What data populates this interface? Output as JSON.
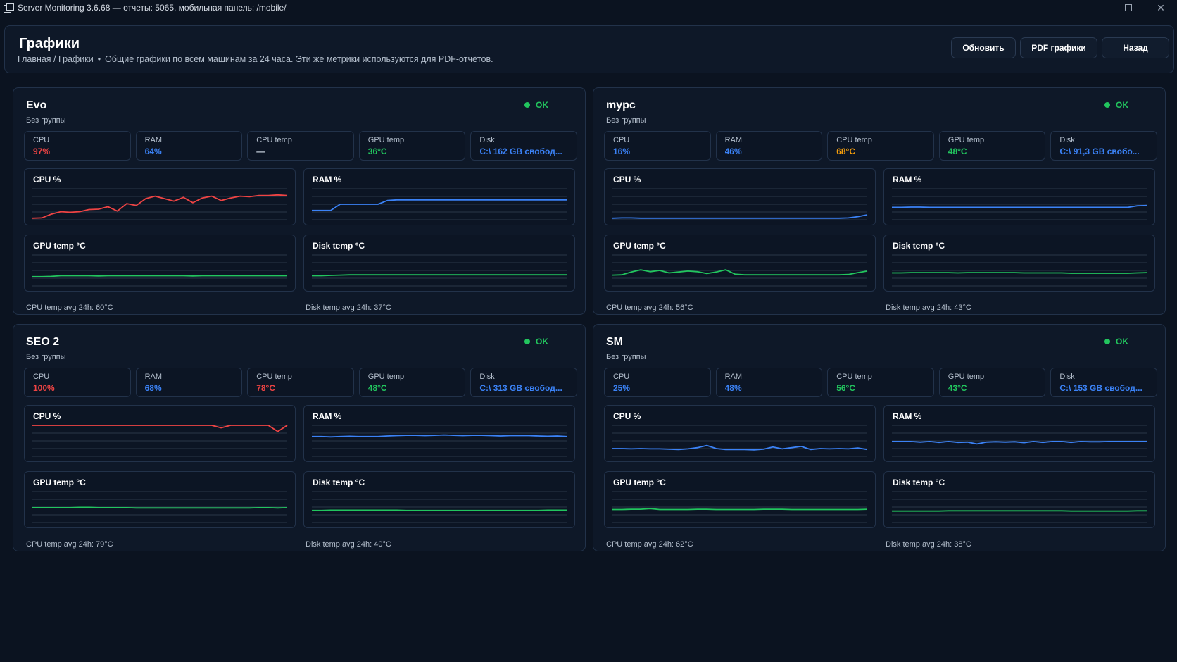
{
  "window": {
    "title": "Server Monitoring 3.6.68 — отчеты: 5065, мобильная панель: /mobile/",
    "minimize": "–",
    "close": "✕"
  },
  "header": {
    "title": "Графики",
    "breadcrumb": "Главная / Графики",
    "separator": "•",
    "description": "Общие графики по всем машинам за 24 часа. Эти же метрики используются для PDF-отчётов.",
    "buttons": {
      "refresh": "Обновить",
      "pdf": "PDF графики",
      "back": "Назад"
    }
  },
  "colors": {
    "red": "#ef4444",
    "blue": "#3b82f6",
    "green": "#22c55e",
    "orange": "#f59e0b",
    "muted": "#c9d2de"
  },
  "metric_labels": {
    "cpu": "CPU",
    "ram": "RAM",
    "cpu_temp": "CPU temp",
    "gpu_temp": "GPU temp",
    "disk": "Disk"
  },
  "chart_titles": {
    "cpu": "CPU %",
    "ram": "RAM %",
    "gpu_temp": "GPU temp °C",
    "disk_temp": "Disk temp °C"
  },
  "machines": [
    {
      "name": "Evo",
      "group": "Без группы",
      "status": "OK",
      "metrics": {
        "cpu": {
          "value": "97%",
          "color": "red"
        },
        "ram": {
          "value": "64%",
          "color": "blue"
        },
        "cpu_temp": {
          "value": "—",
          "color": "muted"
        },
        "gpu_temp": {
          "value": "36°C",
          "color": "green"
        },
        "disk": {
          "value": "C:\\ 162 GB свобод...",
          "color": "blue"
        }
      },
      "cpu_temp_avg": "CPU temp avg 24h: 60°C",
      "disk_temp_avg": "Disk temp avg 24h: 37°C"
    },
    {
      "name": "mypc",
      "group": "Без группы",
      "status": "OK",
      "metrics": {
        "cpu": {
          "value": "16%",
          "color": "blue"
        },
        "ram": {
          "value": "46%",
          "color": "blue"
        },
        "cpu_temp": {
          "value": "68°C",
          "color": "orange"
        },
        "gpu_temp": {
          "value": "48°C",
          "color": "green"
        },
        "disk": {
          "value": "C:\\ 91,3 GB свобо...",
          "color": "blue"
        }
      },
      "cpu_temp_avg": "CPU temp avg 24h: 56°C",
      "disk_temp_avg": "Disk temp avg 24h: 43°C"
    },
    {
      "name": "SEO 2",
      "group": "Без группы",
      "status": "OK",
      "metrics": {
        "cpu": {
          "value": "100%",
          "color": "red"
        },
        "ram": {
          "value": "68%",
          "color": "blue"
        },
        "cpu_temp": {
          "value": "78°C",
          "color": "red"
        },
        "gpu_temp": {
          "value": "48°C",
          "color": "green"
        },
        "disk": {
          "value": "C:\\ 313 GB свобод...",
          "color": "blue"
        }
      },
      "cpu_temp_avg": "CPU temp avg 24h: 79°C",
      "disk_temp_avg": "Disk temp avg 24h: 40°C"
    },
    {
      "name": "SM",
      "group": "Без группы",
      "status": "OK",
      "metrics": {
        "cpu": {
          "value": "25%",
          "color": "blue"
        },
        "ram": {
          "value": "48%",
          "color": "blue"
        },
        "cpu_temp": {
          "value": "56°C",
          "color": "green"
        },
        "gpu_temp": {
          "value": "43°C",
          "color": "green"
        },
        "disk": {
          "value": "C:\\ 153 GB свобод...",
          "color": "blue"
        }
      },
      "cpu_temp_avg": "CPU temp avg 24h: 62°C",
      "disk_temp_avg": "Disk temp avg 24h: 38°C"
    }
  ],
  "chart_data": [
    {
      "type": "line",
      "machine": "Evo",
      "title": "CPU %",
      "color": "red",
      "ylim": [
        0,
        100
      ],
      "values": [
        5,
        6,
        18,
        26,
        24,
        26,
        33,
        34,
        42,
        28,
        52,
        46,
        68,
        76,
        68,
        60,
        72,
        55,
        70,
        76,
        62,
        70,
        76,
        74,
        78,
        78,
        80,
        78
      ]
    },
    {
      "type": "line",
      "machine": "Evo",
      "title": "RAM %",
      "color": "blue",
      "ylim": [
        0,
        100
      ],
      "values": [
        30,
        30,
        30,
        50,
        50,
        50,
        50,
        50,
        62,
        64,
        64,
        64,
        64,
        64,
        64,
        64,
        64,
        64,
        64,
        64,
        64,
        64,
        64,
        64,
        64,
        64,
        64,
        64
      ]
    },
    {
      "type": "line",
      "machine": "Evo",
      "title": "GPU temp °C",
      "color": "green",
      "ylim": [
        0,
        100
      ],
      "values": [
        30,
        30,
        31,
        33,
        33,
        33,
        33,
        32,
        33,
        33,
        33,
        33,
        33,
        33,
        33,
        33,
        33,
        32,
        33,
        33,
        33,
        33,
        33,
        33,
        33,
        33,
        33,
        33
      ]
    },
    {
      "type": "line",
      "machine": "Evo",
      "title": "Disk temp °C",
      "color": "green",
      "ylim": [
        0,
        100
      ],
      "values": [
        33,
        33,
        34,
        35,
        36,
        36,
        36,
        36,
        36,
        36,
        36,
        36,
        36,
        36,
        36,
        36,
        36,
        36,
        36,
        36,
        36,
        36,
        36,
        36,
        36,
        36,
        36,
        36
      ]
    },
    {
      "type": "line",
      "machine": "mypc",
      "title": "CPU %",
      "color": "blue",
      "ylim": [
        0,
        100
      ],
      "values": [
        5,
        6,
        6,
        5,
        5,
        5,
        5,
        5,
        5,
        5,
        5,
        5,
        5,
        5,
        5,
        5,
        5,
        5,
        5,
        5,
        5,
        5,
        5,
        5,
        5,
        6,
        10,
        16
      ]
    },
    {
      "type": "line",
      "machine": "mypc",
      "title": "RAM %",
      "color": "blue",
      "ylim": [
        0,
        100
      ],
      "values": [
        40,
        40,
        41,
        41,
        40,
        40,
        40,
        40,
        40,
        40,
        40,
        40,
        40,
        40,
        40,
        40,
        40,
        40,
        40,
        40,
        40,
        40,
        40,
        40,
        40,
        40,
        45,
        46
      ]
    },
    {
      "type": "line",
      "machine": "mypc",
      "title": "GPU temp °C",
      "color": "green",
      "ylim": [
        0,
        100
      ],
      "values": [
        35,
        36,
        45,
        52,
        46,
        50,
        42,
        45,
        48,
        46,
        40,
        45,
        52,
        38,
        36,
        36,
        36,
        36,
        36,
        36,
        36,
        36,
        36,
        36,
        36,
        37,
        43,
        48
      ]
    },
    {
      "type": "line",
      "machine": "mypc",
      "title": "Disk temp °C",
      "color": "green",
      "ylim": [
        0,
        100
      ],
      "values": [
        42,
        42,
        43,
        43,
        43,
        43,
        43,
        42,
        43,
        43,
        43,
        43,
        43,
        43,
        42,
        42,
        42,
        42,
        42,
        41,
        41,
        41,
        41,
        41,
        41,
        41,
        42,
        43
      ]
    },
    {
      "type": "line",
      "machine": "SEO 2",
      "title": "CPU %",
      "color": "red",
      "ylim": [
        0,
        100
      ],
      "values": [
        100,
        100,
        100,
        100,
        100,
        100,
        100,
        100,
        100,
        100,
        100,
        100,
        100,
        100,
        100,
        100,
        100,
        100,
        100,
        100,
        92,
        100,
        100,
        100,
        100,
        100,
        80,
        100
      ]
    },
    {
      "type": "line",
      "machine": "SEO 2",
      "title": "RAM %",
      "color": "blue",
      "ylim": [
        0,
        100
      ],
      "values": [
        64,
        64,
        63,
        64,
        65,
        64,
        64,
        64,
        66,
        67,
        68,
        68,
        67,
        68,
        69,
        68,
        67,
        68,
        68,
        67,
        66,
        67,
        67,
        67,
        66,
        65,
        66,
        64
      ]
    },
    {
      "type": "line",
      "machine": "SEO 2",
      "title": "GPU temp °C",
      "color": "green",
      "ylim": [
        0,
        100
      ],
      "values": [
        48,
        48,
        48,
        48,
        48,
        49,
        49,
        48,
        48,
        48,
        48,
        47,
        47,
        47,
        47,
        47,
        47,
        47,
        47,
        47,
        47,
        47,
        47,
        47,
        48,
        48,
        47,
        48
      ]
    },
    {
      "type": "line",
      "machine": "SEO 2",
      "title": "Disk temp °C",
      "color": "green",
      "ylim": [
        0,
        100
      ],
      "values": [
        39,
        39,
        40,
        40,
        40,
        40,
        40,
        40,
        40,
        40,
        39,
        39,
        39,
        39,
        39,
        39,
        39,
        39,
        39,
        39,
        39,
        39,
        39,
        39,
        39,
        40,
        40,
        40
      ]
    },
    {
      "type": "line",
      "machine": "SM",
      "title": "CPU %",
      "color": "blue",
      "ylim": [
        0,
        100
      ],
      "values": [
        25,
        25,
        24,
        25,
        24,
        24,
        23,
        22,
        24,
        28,
        35,
        25,
        22,
        22,
        22,
        21,
        23,
        30,
        24,
        28,
        32,
        22,
        25,
        24,
        25,
        24,
        27,
        22
      ]
    },
    {
      "type": "line",
      "machine": "SM",
      "title": "RAM %",
      "color": "blue",
      "ylim": [
        0,
        100
      ],
      "values": [
        48,
        48,
        48,
        46,
        48,
        45,
        48,
        45,
        46,
        40,
        46,
        47,
        46,
        47,
        44,
        48,
        45,
        48,
        48,
        45,
        48,
        47,
        47,
        48,
        48,
        48,
        48,
        48
      ]
    },
    {
      "type": "line",
      "machine": "SM",
      "title": "GPU temp °C",
      "color": "green",
      "ylim": [
        0,
        100
      ],
      "values": [
        42,
        42,
        43,
        43,
        45,
        42,
        42,
        42,
        42,
        43,
        43,
        42,
        42,
        42,
        42,
        42,
        43,
        43,
        43,
        42,
        42,
        42,
        42,
        42,
        42,
        42,
        42,
        43
      ]
    },
    {
      "type": "line",
      "machine": "SM",
      "title": "Disk temp °C",
      "color": "green",
      "ylim": [
        0,
        100
      ],
      "values": [
        37,
        37,
        37,
        37,
        37,
        37,
        38,
        38,
        38,
        38,
        38,
        38,
        38,
        38,
        38,
        38,
        38,
        38,
        38,
        37,
        37,
        37,
        37,
        37,
        37,
        37,
        38,
        38
      ]
    }
  ]
}
